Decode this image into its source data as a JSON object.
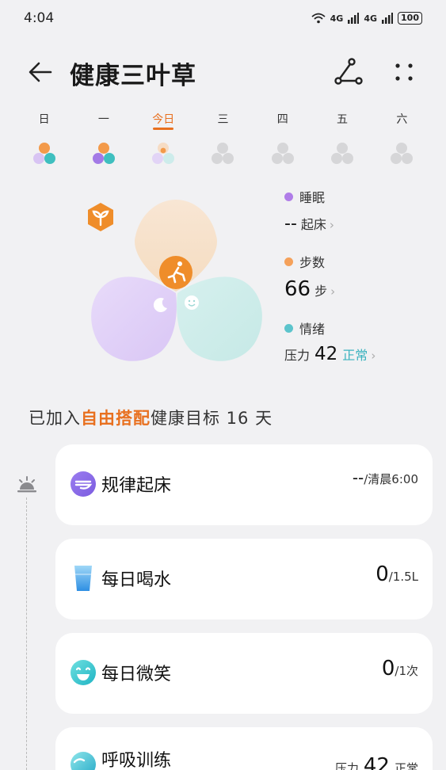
{
  "status": {
    "time": "4:04",
    "signal1": "4G",
    "signal2": "4G",
    "battery": "100"
  },
  "header": {
    "title": "健康三叶草"
  },
  "week": [
    {
      "label": "日",
      "today": false,
      "state": "filled-a"
    },
    {
      "label": "一",
      "today": false,
      "state": "filled-b"
    },
    {
      "label": "今日",
      "today": true,
      "state": "partial"
    },
    {
      "label": "三",
      "today": false,
      "state": "empty"
    },
    {
      "label": "四",
      "today": false,
      "state": "empty"
    },
    {
      "label": "五",
      "today": false,
      "state": "empty"
    },
    {
      "label": "六",
      "today": false,
      "state": "empty"
    }
  ],
  "legend": {
    "sleep": {
      "title": "睡眠",
      "value": "--",
      "unit": "起床",
      "color": "#b07de8"
    },
    "steps": {
      "title": "步数",
      "value": "66",
      "unit": "步",
      "color": "#f5a15a"
    },
    "mood": {
      "title": "情绪",
      "prefix": "压力",
      "value": "42",
      "status": "正常",
      "color": "#5cc4cc"
    }
  },
  "goal": {
    "prefix": "已加入",
    "highlight": "自由搭配",
    "suffix": "健康目标 16 天"
  },
  "cards": [
    {
      "title": "规律起床",
      "value": "--",
      "unit": "/清晨6:00",
      "icon": "wake-icon"
    },
    {
      "title": "每日喝水",
      "value": "0",
      "unit": "/1.5L",
      "icon": "water-cup-icon"
    },
    {
      "title": "每日微笑",
      "value": "0",
      "unit": "/1次",
      "icon": "smile-icon"
    },
    {
      "title": "呼吸训练",
      "value_prefix": "压力",
      "value": "42",
      "unit": "正常",
      "icon": "breath-icon"
    }
  ],
  "colors": {
    "accent": "#e8701f",
    "teal": "#3cb3bf"
  }
}
